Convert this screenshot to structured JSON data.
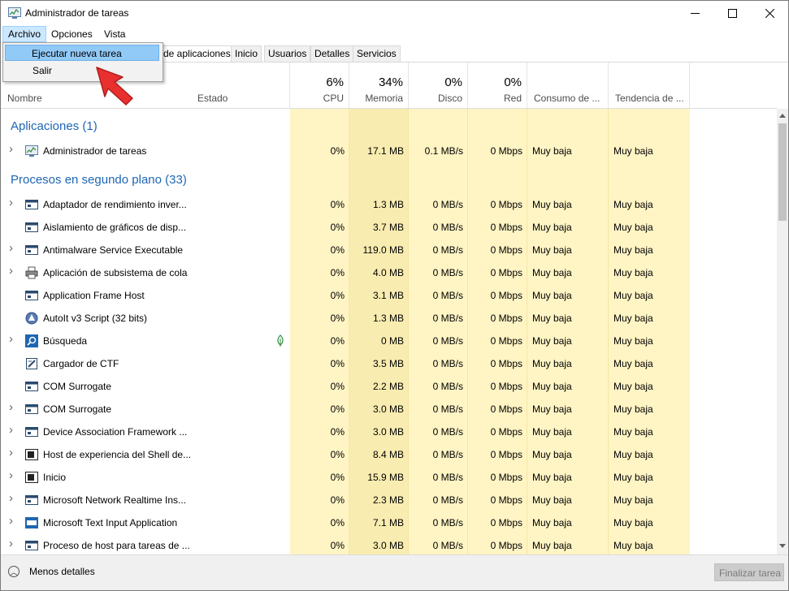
{
  "window": {
    "title": "Administrador de tareas"
  },
  "menu": {
    "items": [
      "Archivo",
      "Opciones",
      "Vista"
    ]
  },
  "dropdown": {
    "items": [
      "Ejecutar nueva tarea",
      "Salir"
    ]
  },
  "tabs": [
    "de aplicaciones",
    "Inicio",
    "Usuarios",
    "Detalles",
    "Servicios"
  ],
  "columns": {
    "name": "Nombre",
    "status": "Estado",
    "cpu": {
      "pct": "6%",
      "label": "CPU"
    },
    "memory": {
      "pct": "34%",
      "label": "Memoria"
    },
    "disk": {
      "pct": "0%",
      "label": "Disco"
    },
    "network": {
      "pct": "0%",
      "label": "Red"
    },
    "power": "Consumo de ...",
    "power_trend": "Tendencia de ..."
  },
  "groups": {
    "apps": "Aplicaciones (1)",
    "background": "Procesos en segundo plano (33)"
  },
  "apps": [
    {
      "name": "Administrador de tareas",
      "cpu": "0%",
      "mem": "17.1 MB",
      "disk": "0.1 MB/s",
      "net": "0 Mbps",
      "power": "Muy baja",
      "trend": "Muy baja",
      "icon": "task-manager-icon",
      "expand": true
    }
  ],
  "background": [
    {
      "name": "Adaptador de rendimiento inver...",
      "cpu": "0%",
      "mem": "1.3 MB",
      "disk": "0 MB/s",
      "net": "0 Mbps",
      "power": "Muy baja",
      "trend": "Muy baja",
      "icon": "window-app-icon",
      "expand": true
    },
    {
      "name": "Aislamiento de gráficos de disp...",
      "cpu": "0%",
      "mem": "3.7 MB",
      "disk": "0 MB/s",
      "net": "0 Mbps",
      "power": "Muy baja",
      "trend": "Muy baja",
      "icon": "window-app-icon",
      "expand": false
    },
    {
      "name": "Antimalware Service Executable",
      "cpu": "0%",
      "mem": "119.0 MB",
      "disk": "0 MB/s",
      "net": "0 Mbps",
      "power": "Muy baja",
      "trend": "Muy baja",
      "icon": "window-app-icon",
      "expand": true
    },
    {
      "name": "Aplicación de subsistema de cola",
      "cpu": "0%",
      "mem": "4.0 MB",
      "disk": "0 MB/s",
      "net": "0 Mbps",
      "power": "Muy baja",
      "trend": "Muy baja",
      "icon": "printer-icon",
      "expand": true
    },
    {
      "name": "Application Frame Host",
      "cpu": "0%",
      "mem": "3.1 MB",
      "disk": "0 MB/s",
      "net": "0 Mbps",
      "power": "Muy baja",
      "trend": "Muy baja",
      "icon": "window-app-icon",
      "expand": false
    },
    {
      "name": "AutoIt v3 Script (32 bits)",
      "cpu": "0%",
      "mem": "1.3 MB",
      "disk": "0 MB/s",
      "net": "0 Mbps",
      "power": "Muy baja",
      "trend": "Muy baja",
      "icon": "autoit-icon",
      "expand": false
    },
    {
      "name": "Búsqueda",
      "cpu": "0%",
      "mem": "0 MB",
      "disk": "0 MB/s",
      "net": "0 Mbps",
      "power": "Muy baja",
      "trend": "Muy baja",
      "icon": "search-icon",
      "expand": true,
      "leaf": true
    },
    {
      "name": "Cargador de CTF",
      "cpu": "0%",
      "mem": "3.5 MB",
      "disk": "0 MB/s",
      "net": "0 Mbps",
      "power": "Muy baja",
      "trend": "Muy baja",
      "icon": "ctf-loader-icon",
      "expand": false
    },
    {
      "name": "COM Surrogate",
      "cpu": "0%",
      "mem": "2.2 MB",
      "disk": "0 MB/s",
      "net": "0 Mbps",
      "power": "Muy baja",
      "trend": "Muy baja",
      "icon": "window-app-icon",
      "expand": false
    },
    {
      "name": "COM Surrogate",
      "cpu": "0%",
      "mem": "3.0 MB",
      "disk": "0 MB/s",
      "net": "0 Mbps",
      "power": "Muy baja",
      "trend": "Muy baja",
      "icon": "window-app-icon",
      "expand": true
    },
    {
      "name": "Device Association Framework ...",
      "cpu": "0%",
      "mem": "3.0 MB",
      "disk": "0 MB/s",
      "net": "0 Mbps",
      "power": "Muy baja",
      "trend": "Muy baja",
      "icon": "window-app-icon",
      "expand": true
    },
    {
      "name": "Host de experiencia del Shell de...",
      "cpu": "0%",
      "mem": "8.4 MB",
      "disk": "0 MB/s",
      "net": "0 Mbps",
      "power": "Muy baja",
      "trend": "Muy baja",
      "icon": "shell-host-icon",
      "expand": true
    },
    {
      "name": "Inicio",
      "cpu": "0%",
      "mem": "15.9 MB",
      "disk": "0 MB/s",
      "net": "0 Mbps",
      "power": "Muy baja",
      "trend": "Muy baja",
      "icon": "shell-host-icon",
      "expand": true
    },
    {
      "name": "Microsoft Network Realtime Ins...",
      "cpu": "0%",
      "mem": "2.3 MB",
      "disk": "0 MB/s",
      "net": "0 Mbps",
      "power": "Muy baja",
      "trend": "Muy baja",
      "icon": "window-app-icon",
      "expand": true
    },
    {
      "name": "Microsoft Text Input Application",
      "cpu": "0%",
      "mem": "7.1 MB",
      "disk": "0 MB/s",
      "net": "0 Mbps",
      "power": "Muy baja",
      "trend": "Muy baja",
      "icon": "text-input-icon",
      "expand": true
    },
    {
      "name": "Proceso de host para tareas de ...",
      "cpu": "0%",
      "mem": "3.0 MB",
      "disk": "0 MB/s",
      "net": "0 Mbps",
      "power": "Muy baja",
      "trend": "Muy baja",
      "icon": "window-app-icon",
      "expand": true
    }
  ],
  "footer": {
    "less": "Menos detalles",
    "end_task": "Finalizar tarea"
  },
  "colors": {
    "accent": "#1e66b3",
    "heat_light": "#fff4c4",
    "heat_mem": "#f9ecb0",
    "menu_highlight": "#91c9f7",
    "arrow": "#e8302f"
  }
}
